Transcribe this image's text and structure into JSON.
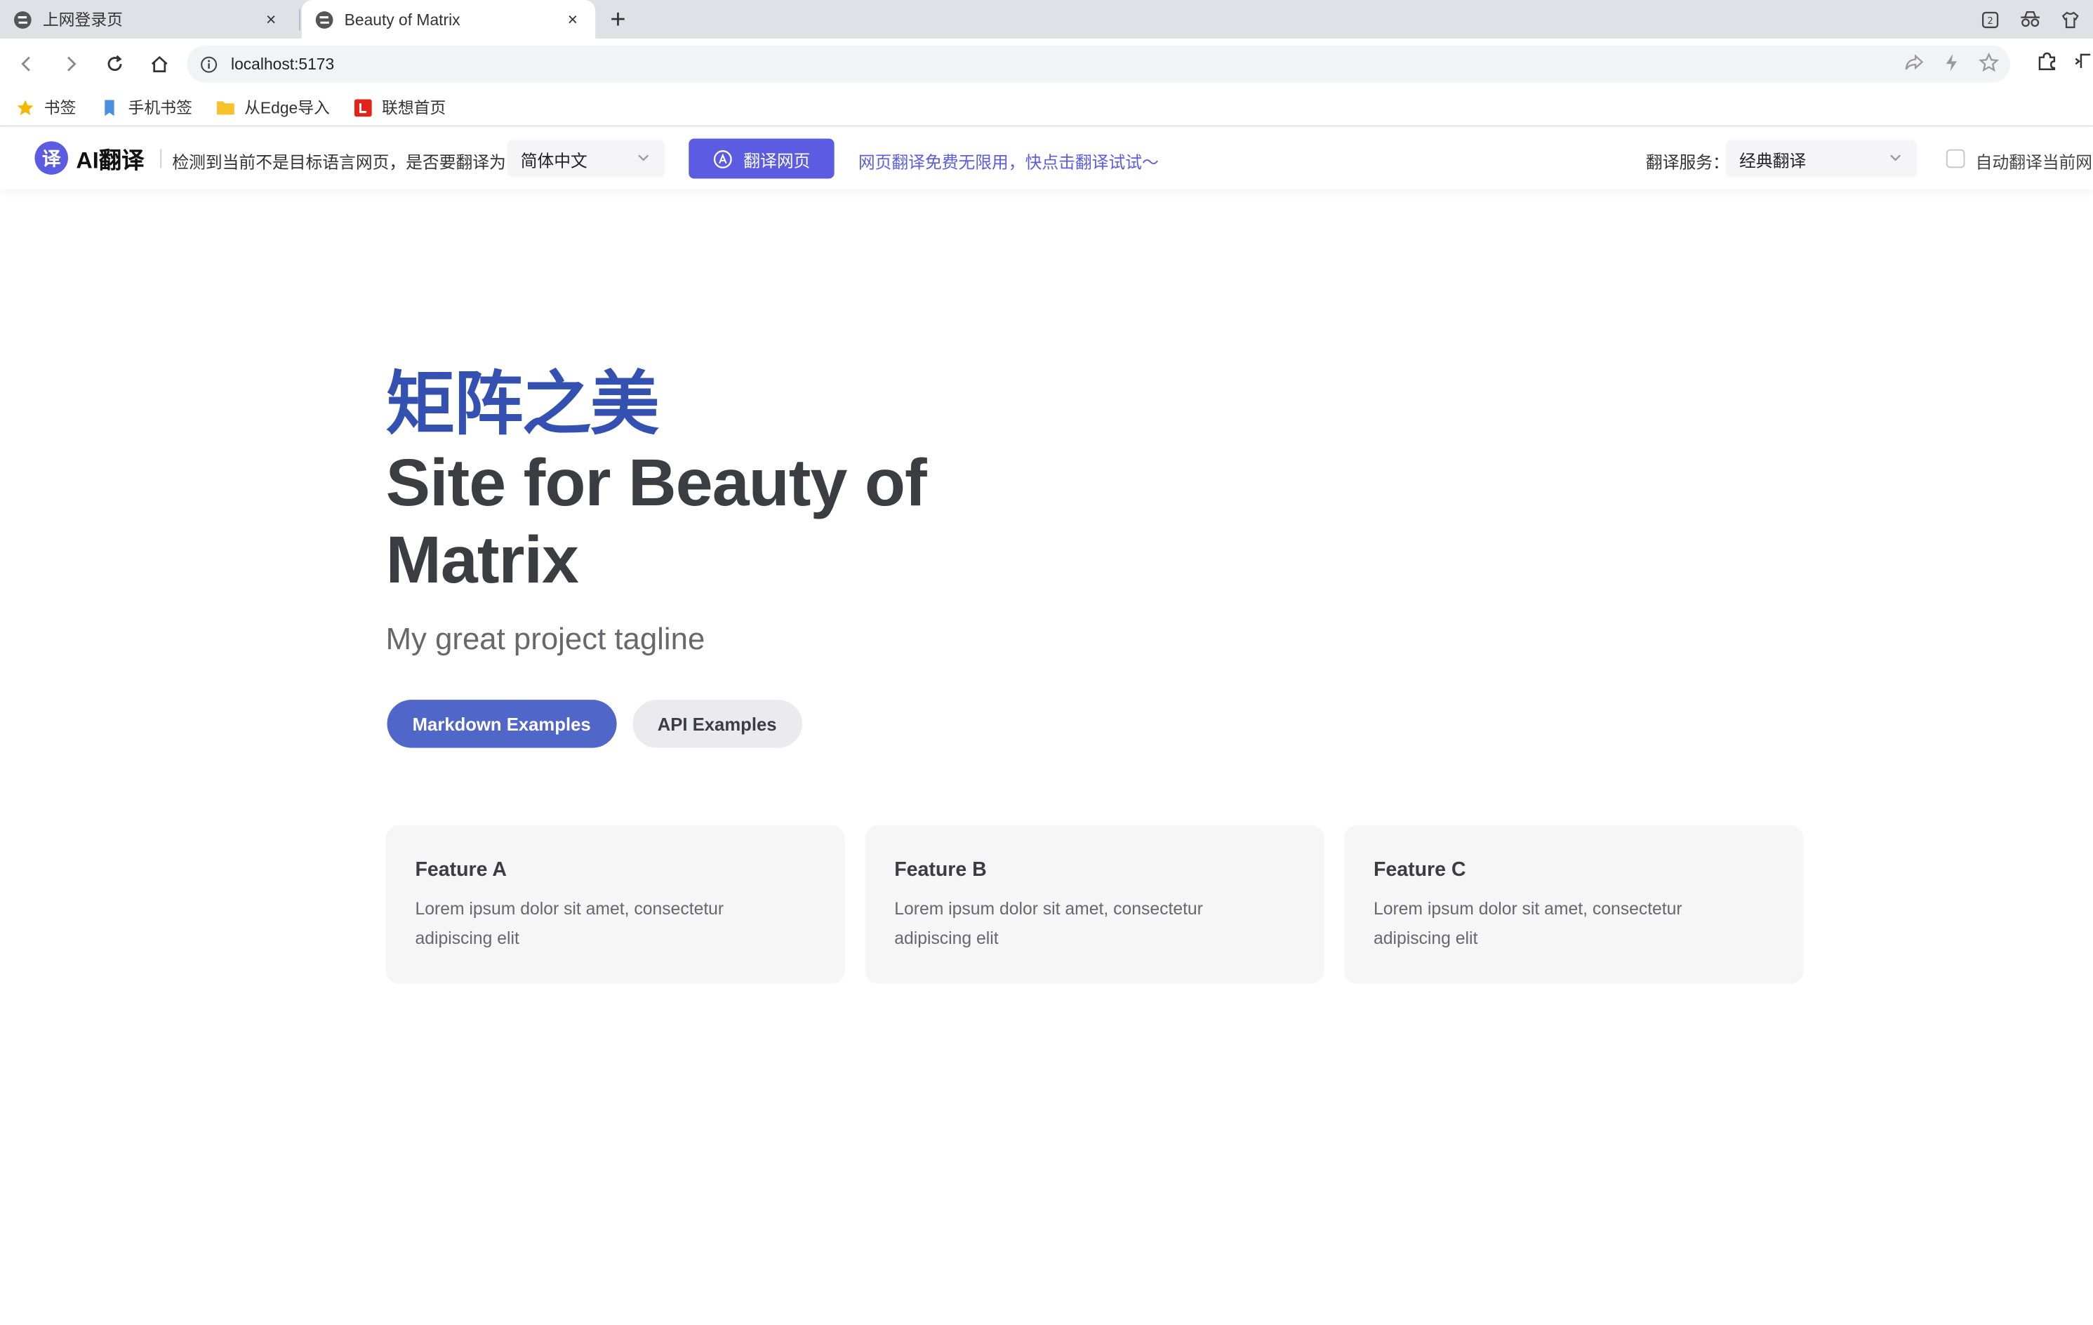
{
  "browser": {
    "tabs": [
      {
        "title": "上网登录页",
        "active": false
      },
      {
        "title": "Beauty of Matrix",
        "active": true
      }
    ],
    "new_tab": "+",
    "tab_close": "×",
    "url": "localhost:5173"
  },
  "bookmarks": [
    {
      "label": "书签",
      "icon": "star-icon"
    },
    {
      "label": "手机书签",
      "icon": "bookmark-icon"
    },
    {
      "label": "从Edge导入",
      "icon": "folder-icon"
    },
    {
      "label": "联想首页",
      "icon": "lenovo-icon"
    }
  ],
  "translate_bar": {
    "logo_glyph": "译",
    "brand": "AI翻译",
    "prompt": "检测到当前不是目标语言网页，是否要翻译为：",
    "target_language": "简体中文",
    "translate_button": "翻译网页",
    "promo": "网页翻译免费无限用，快点击翻译试试～",
    "service_label": "翻译服务：",
    "service_value": "经典翻译",
    "auto_translate": "自动翻译当前网站"
  },
  "hero": {
    "name": "矩阵之美",
    "text": "Site for Beauty of Matrix",
    "tagline": "My great project tagline",
    "actions": [
      {
        "label": "Markdown Examples",
        "theme": "brand"
      },
      {
        "label": "API Examples",
        "theme": "alt"
      }
    ]
  },
  "features": [
    {
      "title": "Feature A",
      "details": "Lorem ipsum dolor sit amet, consectetur adipiscing elit"
    },
    {
      "title": "Feature B",
      "details": "Lorem ipsum dolor sit amet, consectetur adipiscing elit"
    },
    {
      "title": "Feature C",
      "details": "Lorem ipsum dolor sit amet, consectetur adipiscing elit"
    }
  ],
  "colors": {
    "brand": "#3451b2",
    "translate_accent": "#5b5ce2",
    "text_dark": "#3c3c43",
    "text_muted": "#67676c"
  }
}
